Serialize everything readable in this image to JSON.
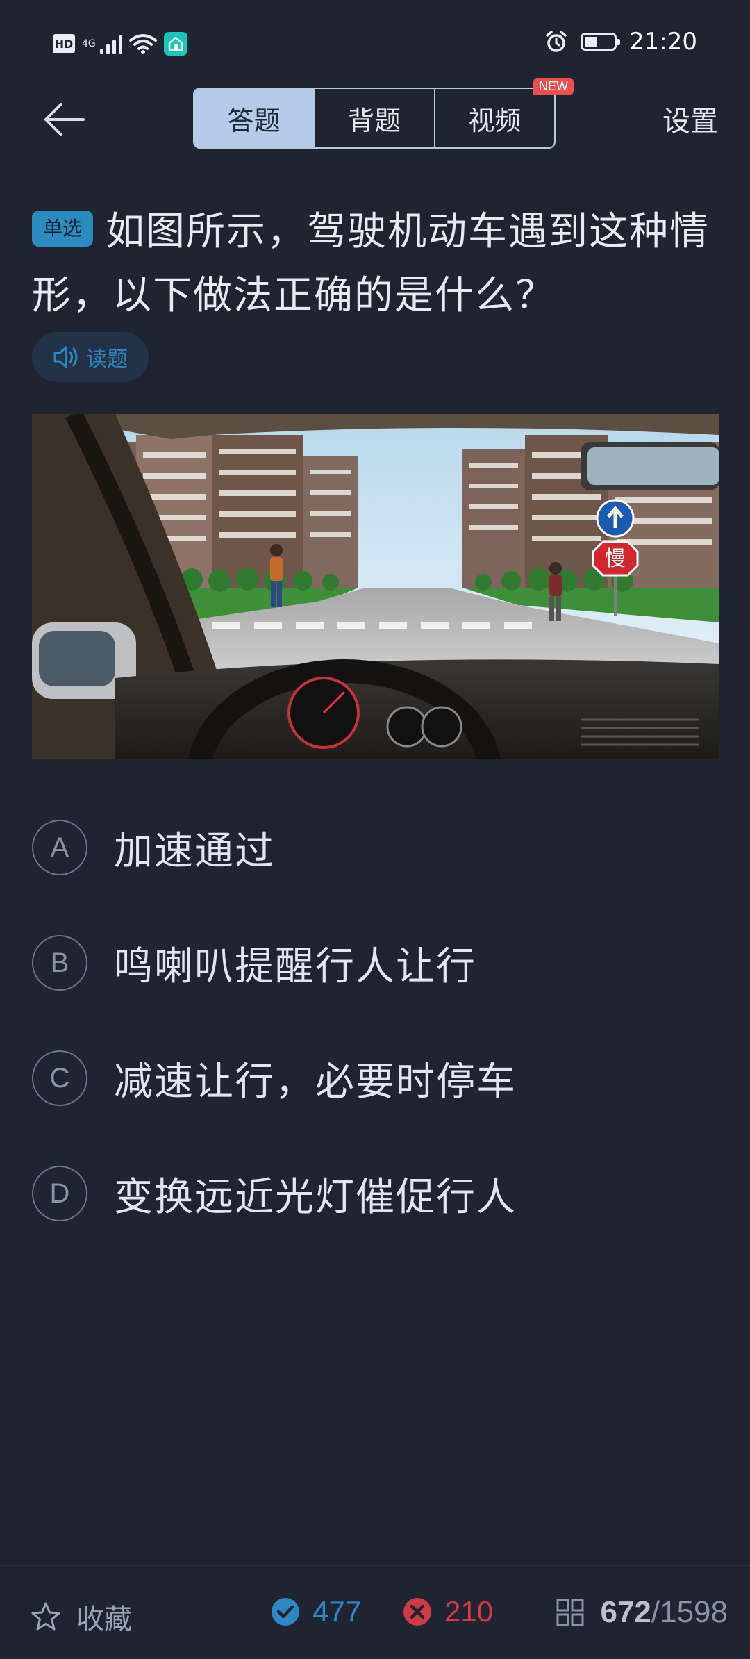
{
  "status_bar": {
    "hd": "HD",
    "network": "4G",
    "time": "21:20",
    "battery_level": 0.45
  },
  "header": {
    "tabs": [
      {
        "label": "答题",
        "active": true
      },
      {
        "label": "背题",
        "active": false
      },
      {
        "label": "视频",
        "active": false
      }
    ],
    "new_badge": "NEW",
    "settings_label": "设置"
  },
  "question": {
    "type_label": "单选",
    "text": "如图所示，驾驶机动车遇到这种情形，以下做法正确的是什么？",
    "read_label": "读题"
  },
  "scene": {
    "sign_slow": "慢"
  },
  "options": [
    {
      "letter": "A",
      "text": "加速通过"
    },
    {
      "letter": "B",
      "text": "鸣喇叭提醒行人让行"
    },
    {
      "letter": "C",
      "text": "减速让行，必要时停车"
    },
    {
      "letter": "D",
      "text": "变换远近光灯催促行人"
    }
  ],
  "bottom_bar": {
    "favorite_label": "收藏",
    "correct_count": "477",
    "wrong_count": "210",
    "current": "672",
    "total": "/1598"
  },
  "colors": {
    "background": "#1f2431",
    "accent_blue": "#2f86c4",
    "wrong_red": "#d03a46",
    "tab_active": "#b6cbe5",
    "new_badge": "#ee4e4e"
  }
}
